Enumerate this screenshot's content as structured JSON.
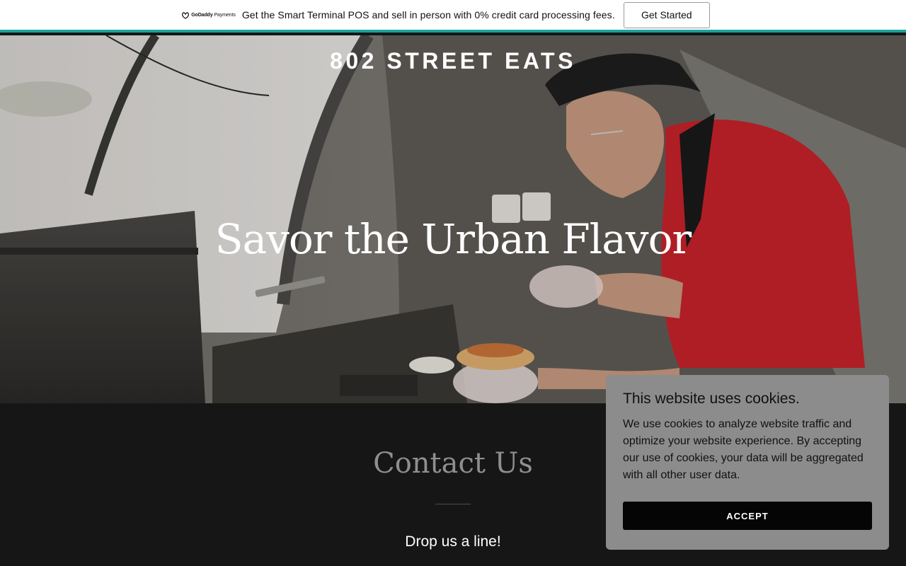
{
  "promo": {
    "logo_brand": "GoDaddy",
    "logo_product": "Payments",
    "text": "Get the Smart Terminal POS and sell in person with 0% credit card processing fees.",
    "button": "Get Started",
    "accent_color": "#1ba39c"
  },
  "hero": {
    "site_title": "802 STREET EATS",
    "headline": "Savor the Urban Flavor"
  },
  "contact": {
    "title": "Contact Us",
    "subtitle": "Drop us a line!"
  },
  "cookie": {
    "title": "This website uses cookies.",
    "text": "We use cookies to analyze website traffic and optimize your website experience. By accepting our use of cookies, your data will be aggregated with all other user data.",
    "button": "ACCEPT"
  }
}
